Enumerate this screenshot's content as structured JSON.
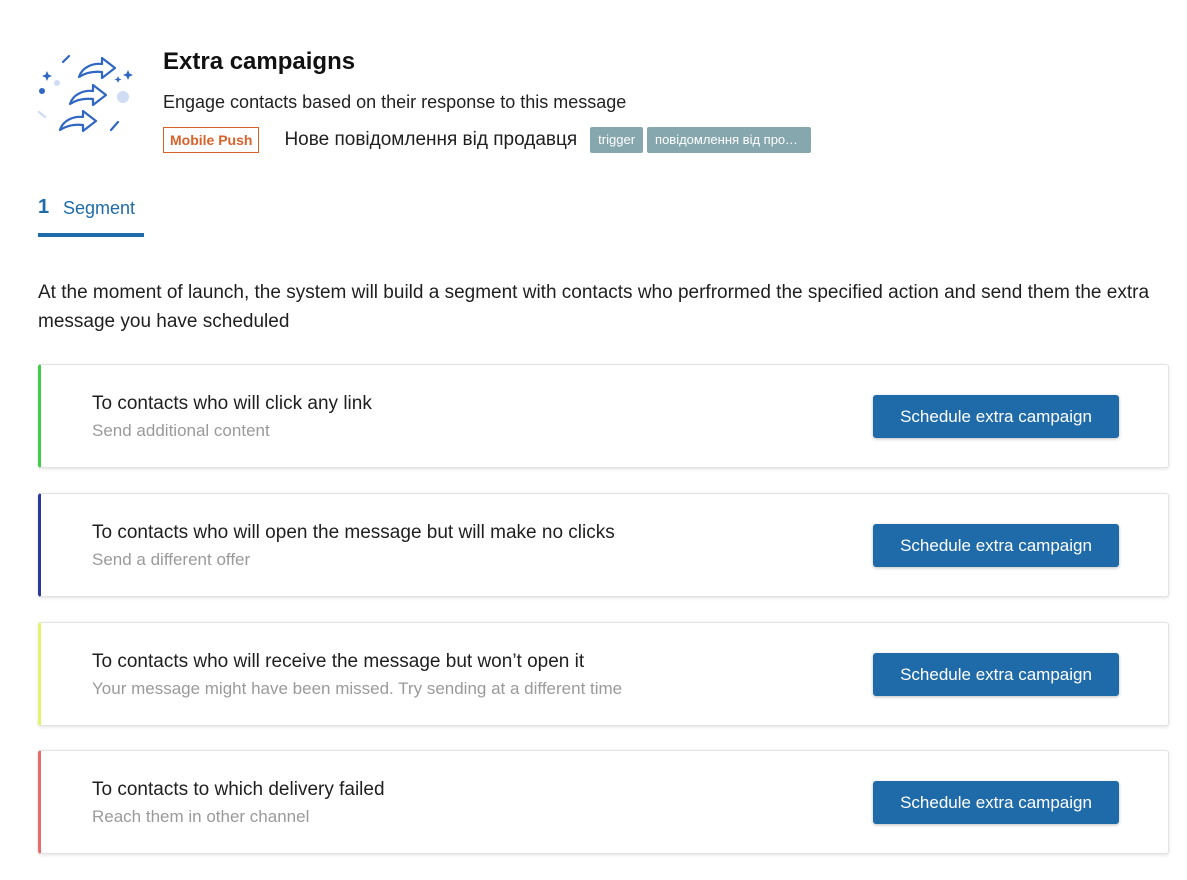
{
  "header": {
    "title": "Extra campaigns",
    "subtitle": "Engage contacts based on their response to this message",
    "channel_badge": "Mobile Push",
    "message_name": "Нове повідомлення від продавця",
    "tags": [
      "trigger",
      "повідомлення від прод..."
    ],
    "illustration_icon": "forward-arrows-illustration"
  },
  "tabs": [
    {
      "number": "1",
      "label": "Segment"
    }
  ],
  "description": "At the moment of launch, the system will build a segment with contacts who perfrormed the specified action and send them the extra message you have scheduled",
  "cards": [
    {
      "title": "To contacts who will click any link",
      "subtitle": "Send additional content",
      "button_label": "Schedule extra campaign",
      "accent_color": "#3ecf4a"
    },
    {
      "title": "To contacts who will open the message but will make no clicks",
      "subtitle": "Send a different offer",
      "button_label": "Schedule extra campaign",
      "accent_color": "#2b3a9c"
    },
    {
      "title": "To contacts who will receive the message but won’t open it",
      "subtitle": "Your message might have been missed. Try sending at a different time",
      "button_label": "Schedule extra campaign",
      "accent_color": "#e5f36a"
    },
    {
      "title": "To contacts to which delivery failed",
      "subtitle": "Reach them in other channel",
      "button_label": "Schedule extra campaign",
      "accent_color": "#e96a6a"
    }
  ],
  "colors": {
    "primary": "#1f6ba9",
    "badge": "#d9622b",
    "tag_bg": "#87a7ae"
  }
}
